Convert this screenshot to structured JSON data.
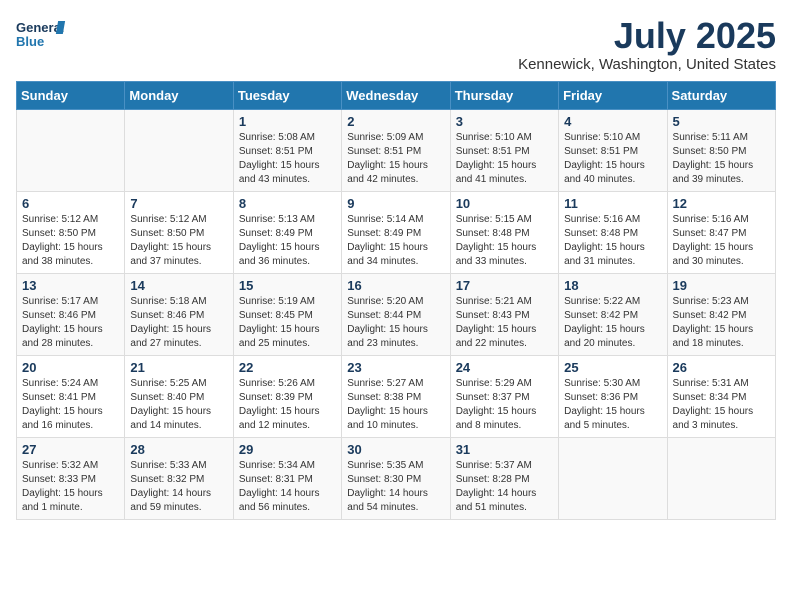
{
  "header": {
    "logo_line1": "General",
    "logo_line2": "Blue",
    "month_title": "July 2025",
    "location": "Kennewick, Washington, United States"
  },
  "days_of_week": [
    "Sunday",
    "Monday",
    "Tuesday",
    "Wednesday",
    "Thursday",
    "Friday",
    "Saturday"
  ],
  "weeks": [
    [
      {
        "day": "",
        "content": ""
      },
      {
        "day": "",
        "content": ""
      },
      {
        "day": "1",
        "content": "Sunrise: 5:08 AM\nSunset: 8:51 PM\nDaylight: 15 hours\nand 43 minutes."
      },
      {
        "day": "2",
        "content": "Sunrise: 5:09 AM\nSunset: 8:51 PM\nDaylight: 15 hours\nand 42 minutes."
      },
      {
        "day": "3",
        "content": "Sunrise: 5:10 AM\nSunset: 8:51 PM\nDaylight: 15 hours\nand 41 minutes."
      },
      {
        "day": "4",
        "content": "Sunrise: 5:10 AM\nSunset: 8:51 PM\nDaylight: 15 hours\nand 40 minutes."
      },
      {
        "day": "5",
        "content": "Sunrise: 5:11 AM\nSunset: 8:50 PM\nDaylight: 15 hours\nand 39 minutes."
      }
    ],
    [
      {
        "day": "6",
        "content": "Sunrise: 5:12 AM\nSunset: 8:50 PM\nDaylight: 15 hours\nand 38 minutes."
      },
      {
        "day": "7",
        "content": "Sunrise: 5:12 AM\nSunset: 8:50 PM\nDaylight: 15 hours\nand 37 minutes."
      },
      {
        "day": "8",
        "content": "Sunrise: 5:13 AM\nSunset: 8:49 PM\nDaylight: 15 hours\nand 36 minutes."
      },
      {
        "day": "9",
        "content": "Sunrise: 5:14 AM\nSunset: 8:49 PM\nDaylight: 15 hours\nand 34 minutes."
      },
      {
        "day": "10",
        "content": "Sunrise: 5:15 AM\nSunset: 8:48 PM\nDaylight: 15 hours\nand 33 minutes."
      },
      {
        "day": "11",
        "content": "Sunrise: 5:16 AM\nSunset: 8:48 PM\nDaylight: 15 hours\nand 31 minutes."
      },
      {
        "day": "12",
        "content": "Sunrise: 5:16 AM\nSunset: 8:47 PM\nDaylight: 15 hours\nand 30 minutes."
      }
    ],
    [
      {
        "day": "13",
        "content": "Sunrise: 5:17 AM\nSunset: 8:46 PM\nDaylight: 15 hours\nand 28 minutes."
      },
      {
        "day": "14",
        "content": "Sunrise: 5:18 AM\nSunset: 8:46 PM\nDaylight: 15 hours\nand 27 minutes."
      },
      {
        "day": "15",
        "content": "Sunrise: 5:19 AM\nSunset: 8:45 PM\nDaylight: 15 hours\nand 25 minutes."
      },
      {
        "day": "16",
        "content": "Sunrise: 5:20 AM\nSunset: 8:44 PM\nDaylight: 15 hours\nand 23 minutes."
      },
      {
        "day": "17",
        "content": "Sunrise: 5:21 AM\nSunset: 8:43 PM\nDaylight: 15 hours\nand 22 minutes."
      },
      {
        "day": "18",
        "content": "Sunrise: 5:22 AM\nSunset: 8:42 PM\nDaylight: 15 hours\nand 20 minutes."
      },
      {
        "day": "19",
        "content": "Sunrise: 5:23 AM\nSunset: 8:42 PM\nDaylight: 15 hours\nand 18 minutes."
      }
    ],
    [
      {
        "day": "20",
        "content": "Sunrise: 5:24 AM\nSunset: 8:41 PM\nDaylight: 15 hours\nand 16 minutes."
      },
      {
        "day": "21",
        "content": "Sunrise: 5:25 AM\nSunset: 8:40 PM\nDaylight: 15 hours\nand 14 minutes."
      },
      {
        "day": "22",
        "content": "Sunrise: 5:26 AM\nSunset: 8:39 PM\nDaylight: 15 hours\nand 12 minutes."
      },
      {
        "day": "23",
        "content": "Sunrise: 5:27 AM\nSunset: 8:38 PM\nDaylight: 15 hours\nand 10 minutes."
      },
      {
        "day": "24",
        "content": "Sunrise: 5:29 AM\nSunset: 8:37 PM\nDaylight: 15 hours\nand 8 minutes."
      },
      {
        "day": "25",
        "content": "Sunrise: 5:30 AM\nSunset: 8:36 PM\nDaylight: 15 hours\nand 5 minutes."
      },
      {
        "day": "26",
        "content": "Sunrise: 5:31 AM\nSunset: 8:34 PM\nDaylight: 15 hours\nand 3 minutes."
      }
    ],
    [
      {
        "day": "27",
        "content": "Sunrise: 5:32 AM\nSunset: 8:33 PM\nDaylight: 15 hours\nand 1 minute."
      },
      {
        "day": "28",
        "content": "Sunrise: 5:33 AM\nSunset: 8:32 PM\nDaylight: 14 hours\nand 59 minutes."
      },
      {
        "day": "29",
        "content": "Sunrise: 5:34 AM\nSunset: 8:31 PM\nDaylight: 14 hours\nand 56 minutes."
      },
      {
        "day": "30",
        "content": "Sunrise: 5:35 AM\nSunset: 8:30 PM\nDaylight: 14 hours\nand 54 minutes."
      },
      {
        "day": "31",
        "content": "Sunrise: 5:37 AM\nSunset: 8:28 PM\nDaylight: 14 hours\nand 51 minutes."
      },
      {
        "day": "",
        "content": ""
      },
      {
        "day": "",
        "content": ""
      }
    ]
  ]
}
